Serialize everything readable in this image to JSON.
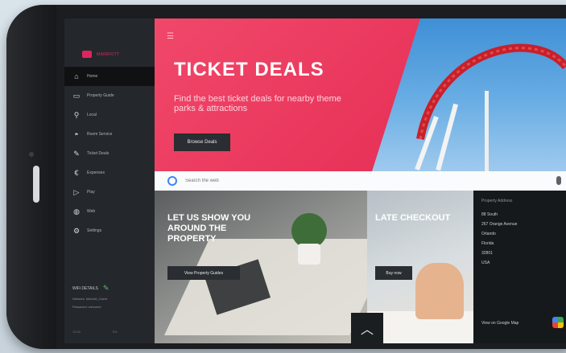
{
  "sidebar": {
    "brand": "MARRIOTT",
    "items": [
      {
        "icon": "home-icon",
        "glyph": "⌂",
        "label": "Home"
      },
      {
        "icon": "property-guide-icon",
        "glyph": "▭",
        "label": "Property Guide"
      },
      {
        "icon": "local-icon",
        "glyph": "⚲",
        "label": "Local"
      },
      {
        "icon": "room-service-icon",
        "glyph": "◓",
        "label": "Room Service"
      },
      {
        "icon": "ticket-deals-icon",
        "glyph": "✎",
        "label": "Ticket Deals"
      },
      {
        "icon": "expense-icon",
        "glyph": "€",
        "label": "Expenses"
      },
      {
        "icon": "play-icon",
        "glyph": "▷",
        "label": "Play"
      },
      {
        "icon": "web-icon",
        "glyph": "◍",
        "label": "Web"
      },
      {
        "icon": "settings-icon",
        "glyph": "⚙",
        "label": "Settings"
      }
    ],
    "wifi_label": "WiFi DETAILS",
    "wifi_lines": [
      "Network: Marriott_Guest",
      "Password: welcome"
    ],
    "footer_left": "12:00",
    "footer_right": "EN"
  },
  "hero": {
    "title": "TICKET DEALS",
    "subtitle": "Find the best ticket deals for nearby theme parks & attractions",
    "button": "Browse Deals"
  },
  "search": {
    "placeholder": "Search the web"
  },
  "property_card": {
    "title": "LET US SHOW YOU AROUND THE PROPERTY",
    "button": "View Property Guides"
  },
  "late_card": {
    "title": "LATE CHECKOUT",
    "button": "Buy now"
  },
  "popular": {
    "title": "Property Address",
    "items": [
      "88 South",
      "267 Orange Avenue",
      "Orlando",
      "Florida",
      "32801",
      "USA"
    ],
    "map_link": "View on Google Map"
  },
  "colors": {
    "accent": "#e0245e",
    "hero_pink": "#ef3f63",
    "sidebar_bg": "#24282c"
  }
}
